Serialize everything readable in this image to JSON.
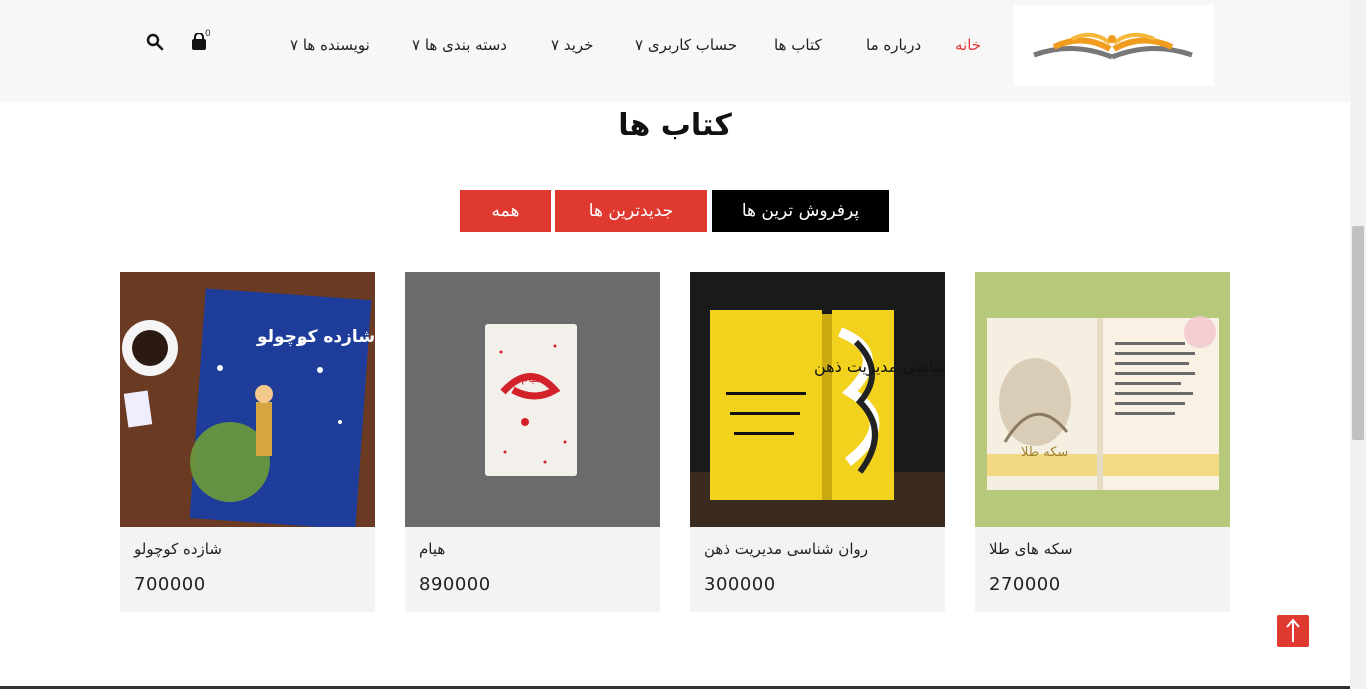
{
  "header": {
    "nav": [
      {
        "label": "خانه",
        "active": true
      },
      {
        "label": "درباره ما"
      },
      {
        "label": "کتاب ها"
      },
      {
        "label": "حساب کاربری ۷"
      },
      {
        "label": "خرید ۷"
      },
      {
        "label": "دسته بندی ها ۷"
      },
      {
        "label": "نویسنده ها ۷"
      }
    ],
    "cart_count": "0",
    "icons": {
      "search": "search-icon",
      "cart": "shopping-bag-icon"
    }
  },
  "section": {
    "title": "کتاب ها"
  },
  "tabs": [
    {
      "label": "همه"
    },
    {
      "label": "جدیدترین ها"
    },
    {
      "label": "پرفروش ترین ها"
    }
  ],
  "books": [
    {
      "name": "سکه های طلا",
      "price": "270000",
      "cover_text": "سکه طلا"
    },
    {
      "name": "روان شناسی مدیریت ذهن",
      "price": "300000",
      "cover_text": "روان شناسی مدیریت ذهن"
    },
    {
      "name": "هیام",
      "price": "890000",
      "cover_text": "هیام"
    },
    {
      "name": "شازده کوچولو",
      "price": "700000",
      "cover_text": "شازده کوچولو"
    }
  ],
  "colors": {
    "accent": "#e0392f",
    "active_nav": "#e53935",
    "black_tab": "#000000"
  }
}
